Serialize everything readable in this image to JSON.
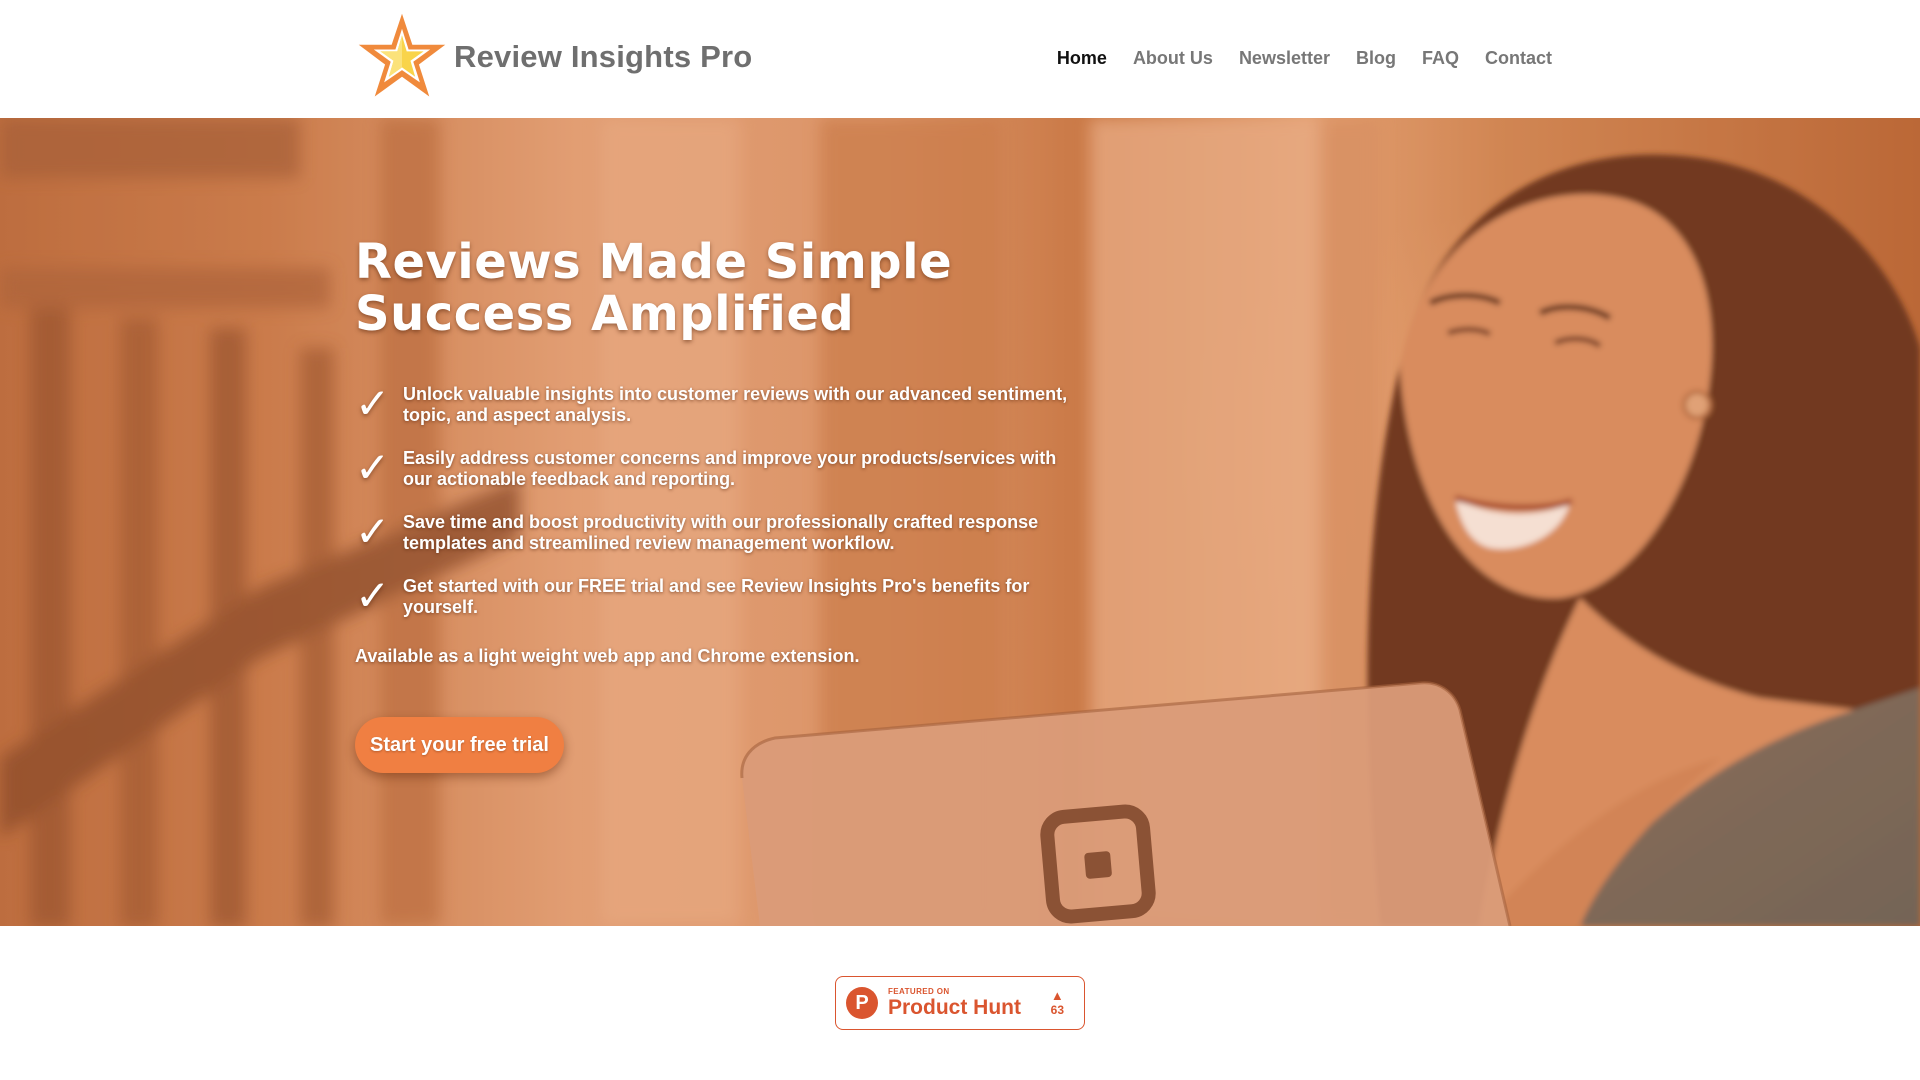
{
  "header": {
    "brand": "Review Insights Pro",
    "nav": [
      {
        "label": "Home",
        "active": true
      },
      {
        "label": "About Us",
        "active": false
      },
      {
        "label": "Newsletter",
        "active": false
      },
      {
        "label": "Blog",
        "active": false
      },
      {
        "label": "FAQ",
        "active": false
      },
      {
        "label": "Contact",
        "active": false
      }
    ]
  },
  "hero": {
    "headline_line1": "Reviews Made Simple",
    "headline_line2": "Success Amplified",
    "check_glyph": "✓",
    "features": [
      "Unlock valuable insights into customer reviews with our advanced sentiment, topic, and aspect analysis.",
      "Easily address customer concerns and improve your products/services with our actionable feedback and reporting.",
      "Save time and boost productivity with our professionally crafted response templates and streamlined review management workflow.",
      "Get started with our FREE trial and see Review Insights Pro's benefits for yourself."
    ],
    "availability": "Available as a light weight web app and Chrome extension.",
    "cta_label": "Start your free trial"
  },
  "product_hunt_badge": {
    "logo_letter": "P",
    "kicker": "FEATURED ON",
    "name": "Product Hunt",
    "upvote_icon": "▲",
    "votes": "63"
  },
  "icons": {
    "logo": "star-icon",
    "feature_bullet": "checkmark-icon",
    "badge_logo": "product-hunt-icon",
    "upvote": "triangle-up-icon"
  },
  "colors": {
    "brand_text": "#6f6f6f",
    "nav_active": "#111111",
    "nav_inactive": "#777777",
    "hero_tint": "#d6804c",
    "cta": "#f07f42",
    "star_outer": "#f08a3c",
    "star_inner": "#f9d44a",
    "product_hunt": "#da552f"
  }
}
